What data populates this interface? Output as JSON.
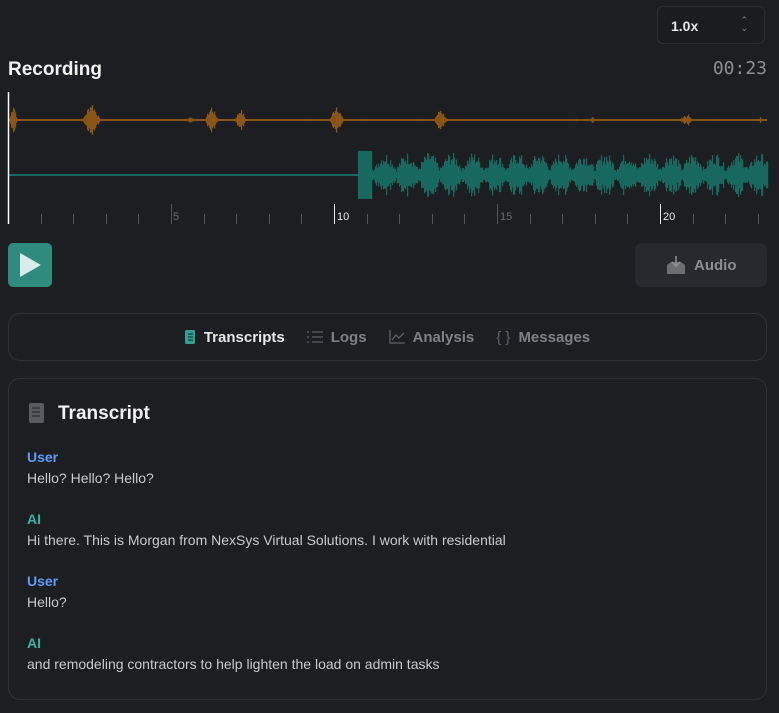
{
  "speed": {
    "value": "1.0x"
  },
  "recording": {
    "title": "Recording",
    "duration": "00:23",
    "timeline_labels": [
      "5",
      "10",
      "15",
      "20"
    ],
    "duration_seconds": 23,
    "playhead_seconds": 0
  },
  "colors": {
    "user_track": "#8a5413",
    "ai_track": "#17695f",
    "accent": "#2e8b7e",
    "user_label": "#5b9df5",
    "ai_label": "#35b3a0"
  },
  "controls": {
    "play_icon": "play-icon",
    "audio_label": "Audio",
    "audio_icon": "download-tray-icon"
  },
  "tabs": [
    {
      "label": "Transcripts",
      "icon": "book-icon",
      "active": true
    },
    {
      "label": "Logs",
      "icon": "list-icon"
    },
    {
      "label": "Analysis",
      "icon": "chart-line-icon"
    },
    {
      "label": "Messages",
      "icon": "braces-icon"
    }
  ],
  "transcript": {
    "title": "Transcript",
    "messages": [
      {
        "speaker": "User",
        "text": "Hello? Hello? Hello?"
      },
      {
        "speaker": "AI",
        "text": "Hi there. This is Morgan from NexSys Virtual Solutions. I work with residential"
      },
      {
        "speaker": "User",
        "text": "Hello?"
      },
      {
        "speaker": "AI",
        "text": "and remodeling contractors to help lighten the load on admin tasks"
      }
    ]
  }
}
